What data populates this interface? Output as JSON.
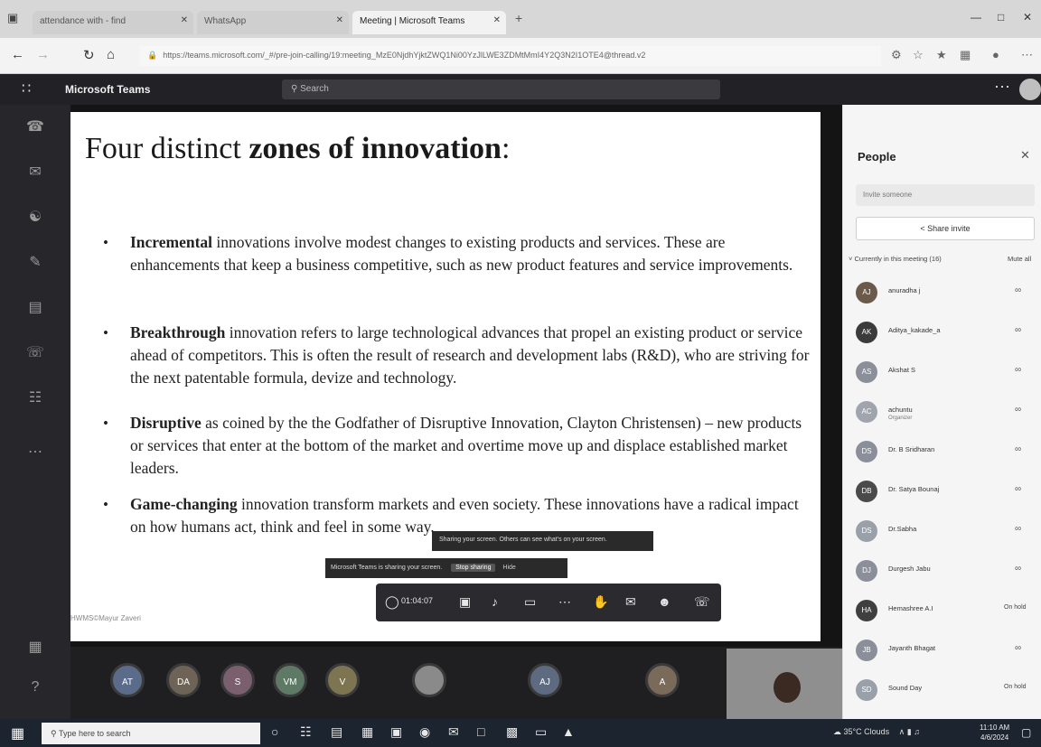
{
  "browser": {
    "tabs": [
      {
        "title": "attendance with - find"
      },
      {
        "title": "WhatsApp"
      },
      {
        "title": "Meeting | Microsoft Teams"
      }
    ],
    "url": "https://teams.microsoft.com/_#/pre-join-calling/19:meeting_MzE0NjdhYjktZWQ1Ni00YzJlLWE3ZDMtMmI4Y2Q3N2I1OTE4@thread.v2"
  },
  "teams": {
    "app_title": "Microsoft Teams",
    "search_placeholder": "Search"
  },
  "slide": {
    "title_plain": "Four distinct ",
    "title_bold": "zones of innovation",
    "title_colon": ":",
    "bullets": [
      {
        "term": "Incremental",
        "text": " innovations involve modest changes to existing products and services. These are enhancements that keep a business competitive, such as new product features and service improvements."
      },
      {
        "term": "Breakthrough",
        "text": " innovation refers to large technological advances that propel an existing product or service ahead of competitors. This is often the result of research and development labs (R&D), who are striving for the next patentable formula, devize and technology."
      },
      {
        "term": "Disruptive",
        "text": " as coined by the the Godfather of Disruptive Innovation, Clayton Christensen) – new products or services that enter at the bottom of the market and overtime move up and displace established market leaders."
      },
      {
        "term": "Game-changing",
        "text": " innovation transform markets and even society. These innovations have a radical impact on how humans act, think and feel in some way."
      }
    ],
    "footer": "HWMS©Mayur Zaveri"
  },
  "sharing": {
    "tip": "Sharing your screen. Others can see what's on your screen.",
    "banner": "Microsoft Teams is sharing your screen.",
    "stop_label": "Stop sharing",
    "hide_label": "Hide"
  },
  "controls": {
    "timer": "01:04:07"
  },
  "participants_strip": [
    {
      "initials": "AT",
      "color": "#5b6b8a"
    },
    {
      "initials": "DA",
      "color": "#6d6357"
    },
    {
      "initials": "S",
      "color": "#7a5f6e"
    },
    {
      "initials": "VM",
      "color": "#5e7a66"
    },
    {
      "initials": "V",
      "color": "#7d7452"
    },
    {
      "initials": "",
      "color": "#8a8a8a"
    },
    {
      "initials": "AJ",
      "color": "#5d6a7f"
    },
    {
      "initials": "A",
      "color": "#7a6a5a"
    }
  ],
  "people": {
    "title": "People",
    "invite_placeholder": "Invite someone",
    "share_invite": "Share invite",
    "current_label": "Currently in this meeting (16)",
    "mute_all": "Mute all",
    "list": [
      {
        "name": "anuradha j",
        "sub": "",
        "initials": "AJ",
        "color": "#6b5a4a",
        "status": "mic"
      },
      {
        "name": "Aditya_kakade_a",
        "sub": "",
        "initials": "AK",
        "color": "#3b3b3b",
        "status": "mic"
      },
      {
        "name": "Akshat S",
        "sub": "",
        "initials": "AS",
        "color": "#8b8f99",
        "status": "mic"
      },
      {
        "name": "achuntu",
        "sub": "Organizer",
        "initials": "AC",
        "color": "#a0a4ad",
        "status": "mic"
      },
      {
        "name": "Dr. B Sridharan",
        "sub": "",
        "initials": "DS",
        "color": "#8b8f99",
        "status": "mic"
      },
      {
        "name": "Dr. Satya Bounaj",
        "sub": "",
        "initials": "DB",
        "color": "#4a4a4a",
        "status": "mic"
      },
      {
        "name": "Dr.Sabha",
        "sub": "",
        "initials": "DS",
        "color": "#9aa0aa",
        "status": "mic"
      },
      {
        "name": "Durgesh Jabu",
        "sub": "",
        "initials": "DJ",
        "color": "#8b8f99",
        "status": "mic"
      },
      {
        "name": "Hemashree A.I",
        "sub": "",
        "initials": "HA",
        "color": "#3f3f3f",
        "status": "On hold"
      },
      {
        "name": "Jayanth Bhagat",
        "sub": "",
        "initials": "JB",
        "color": "#8b8f99",
        "status": "mic"
      },
      {
        "name": "Sound Day",
        "sub": "",
        "initials": "SD",
        "color": "#9aa0aa",
        "status": "On hold"
      }
    ]
  },
  "taskbar": {
    "search_placeholder": "Type here to search",
    "weather": "35°C Clouds",
    "time": "11:10 AM",
    "date": "4/6/2024"
  }
}
